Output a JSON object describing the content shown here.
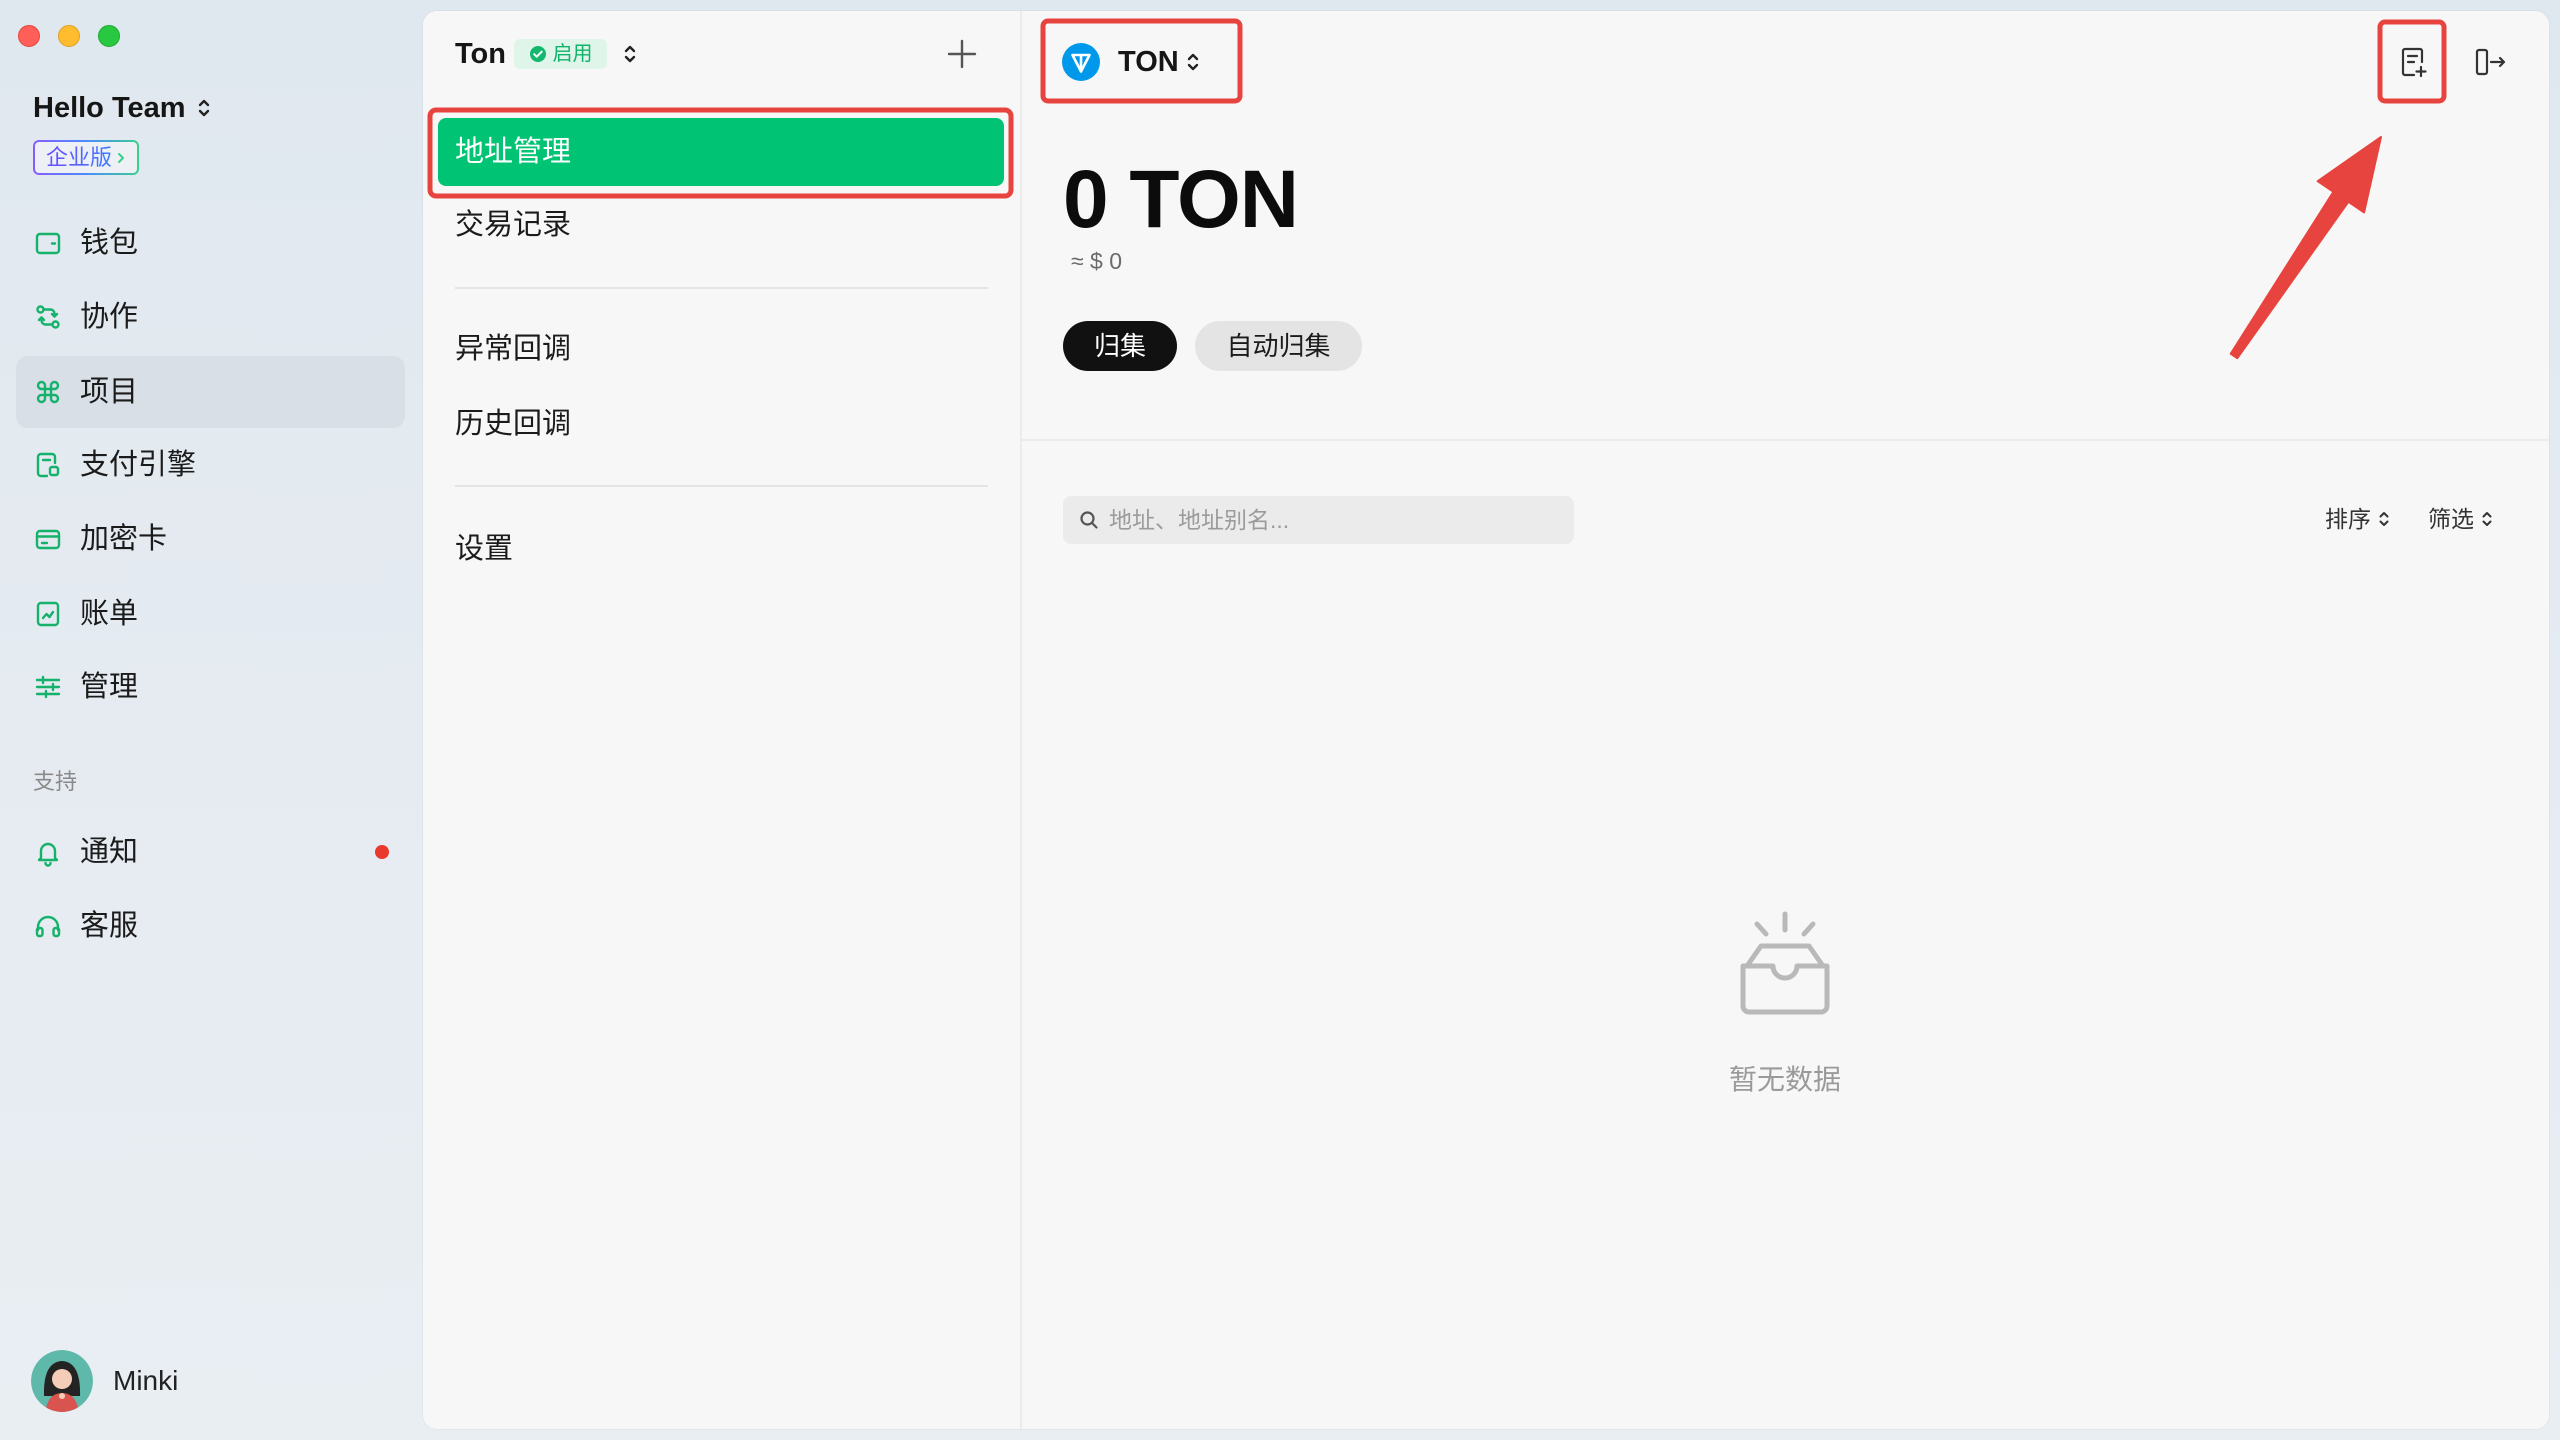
{
  "colors": {
    "accent_green": "#00c373",
    "icon_green": "#14b26b",
    "annotation_red": "#e8443f",
    "alert_red": "#e8392b",
    "ton_blue": "#0098ea"
  },
  "sidebar": {
    "team_name": "Hello Team",
    "plan_badge": "企业版",
    "nav_items": [
      {
        "label": "钱包",
        "icon": "wallet-icon",
        "active": false
      },
      {
        "label": "协作",
        "icon": "collaboration-icon",
        "active": false
      },
      {
        "label": "项目",
        "icon": "project-icon",
        "active": true
      },
      {
        "label": "支付引擎",
        "icon": "payment-engine-icon",
        "active": false
      },
      {
        "label": "加密卡",
        "icon": "crypto-card-icon",
        "active": false
      },
      {
        "label": "账单",
        "icon": "bill-icon",
        "active": false
      },
      {
        "label": "管理",
        "icon": "sliders-icon",
        "active": false
      }
    ],
    "support_section_label": "支持",
    "support_items": [
      {
        "label": "通知",
        "icon": "bell-icon",
        "unread": true
      },
      {
        "label": "客服",
        "icon": "headset-icon",
        "unread": false
      }
    ],
    "user": {
      "name": "Minki"
    }
  },
  "project_panel": {
    "project_name": "Ton",
    "status_badge": "启用",
    "menu_groups": [
      [
        {
          "label": "地址管理",
          "active": true
        },
        {
          "label": "交易记录",
          "active": false
        }
      ],
      [
        {
          "label": "异常回调",
          "active": false
        },
        {
          "label": "历史回调",
          "active": false
        }
      ],
      [
        {
          "label": "设置",
          "active": false
        }
      ]
    ]
  },
  "main": {
    "asset_selector": {
      "symbol": "TON",
      "icon": "ton-logo-icon"
    },
    "header_actions": [
      {
        "icon": "add-document-icon"
      },
      {
        "icon": "exit-icon"
      }
    ],
    "balance": "0 TON",
    "fiat_estimate": "≈ $ 0",
    "actions": [
      {
        "label": "归集",
        "primary": true
      },
      {
        "label": "自动归集",
        "primary": false
      }
    ],
    "search": {
      "placeholder": "地址、地址别名...",
      "value": ""
    },
    "sort_label": "排序",
    "filter_label": "筛选",
    "empty_state": {
      "text": "暂无数据",
      "icon": "empty-inbox-icon"
    }
  }
}
